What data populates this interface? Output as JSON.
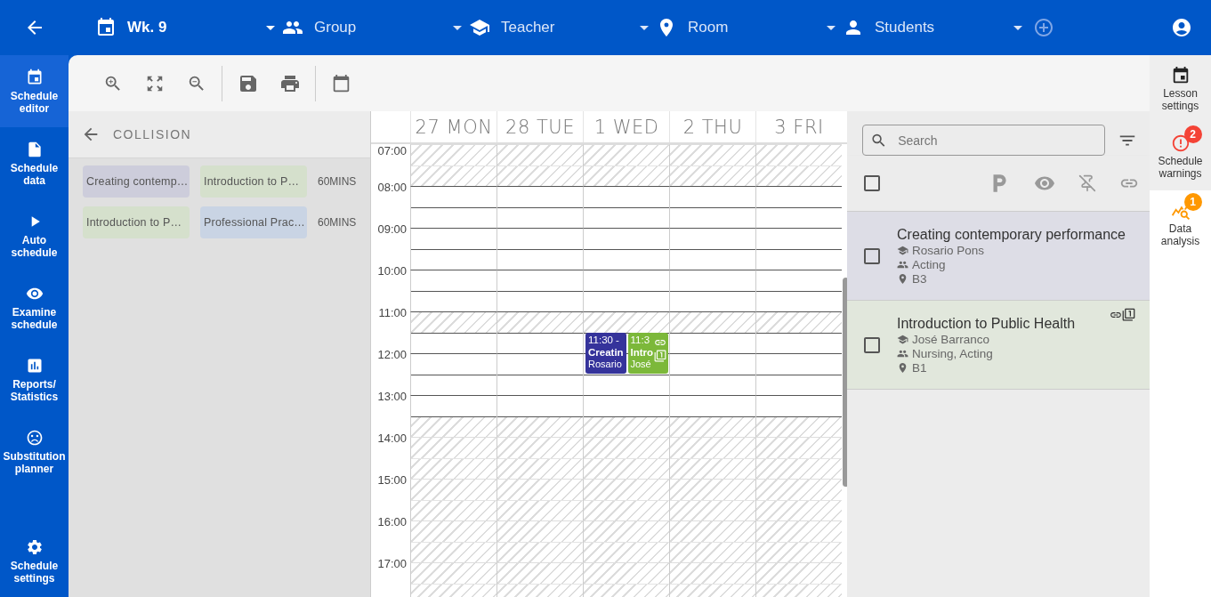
{
  "topbar": {
    "filters": [
      {
        "kind": "week",
        "label": "Wk. 9",
        "active": true
      },
      {
        "kind": "group",
        "label": "Group",
        "active": false
      },
      {
        "kind": "teacher",
        "label": "Teacher",
        "active": false
      },
      {
        "kind": "room",
        "label": "Room",
        "active": false
      },
      {
        "kind": "student",
        "label": "Students",
        "active": false
      }
    ]
  },
  "sidebar": {
    "items": [
      {
        "kind": "editor",
        "label": "Schedule editor",
        "selected": true
      },
      {
        "kind": "data",
        "label": "Schedule data",
        "selected": false
      },
      {
        "kind": "auto",
        "label": "Auto schedule",
        "selected": false
      },
      {
        "kind": "examine",
        "label": "Examine schedule",
        "selected": false
      },
      {
        "kind": "reports",
        "label": "Reports/ Statistics",
        "selected": false
      },
      {
        "kind": "substitution",
        "label": "Substitution planner",
        "selected": false
      },
      {
        "kind": "settings",
        "label": "Schedule settings",
        "selected": false
      }
    ]
  },
  "collision": {
    "title": "COLLISION",
    "pairs": [
      {
        "lessons": [
          {
            "label": "Creating contemp…",
            "color": "#cdcddb"
          },
          {
            "label": "Introduction to P…",
            "color": "#d5e0cc"
          }
        ],
        "duration": "60MINS"
      },
      {
        "lessons": [
          {
            "label": "Introduction to P…",
            "color": "#d5e0cc"
          },
          {
            "label": "Professional Prac…",
            "color": "#c9d4e4"
          }
        ],
        "duration": "60MINS"
      }
    ]
  },
  "calendar": {
    "days": [
      {
        "label": "27 MON"
      },
      {
        "label": "28 TUE"
      },
      {
        "label": "1 WED",
        "events": [
          {
            "time": "11:30 -",
            "title": "Creatin",
            "teacher": "Rosario",
            "color": "#35339b",
            "linked": false,
            "starts_second_half": true
          },
          {
            "time": "11:3",
            "title": "Intro",
            "teacher": "José",
            "color": "#7cb83a",
            "linked": true,
            "starts_second_half": true
          }
        ]
      },
      {
        "label": "2 THU"
      },
      {
        "label": "3 FRI"
      }
    ],
    "hours": [
      {
        "label": "07:00",
        "first_half_blocked": true,
        "second_half_blocked": true
      },
      {
        "label": "08:00",
        "first_half_blocked": false,
        "second_half_blocked": false
      },
      {
        "label": "09:00",
        "first_half_blocked": false,
        "second_half_blocked": false
      },
      {
        "label": "10:00",
        "first_half_blocked": false,
        "second_half_blocked": false
      },
      {
        "label": "11:00",
        "first_half_blocked": true,
        "second_half_blocked": false
      },
      {
        "label": "12:00",
        "first_half_blocked": false,
        "second_half_blocked": false
      },
      {
        "label": "13:00",
        "first_half_blocked": false,
        "second_half_blocked": true
      },
      {
        "label": "14:00",
        "first_half_blocked": true,
        "second_half_blocked": true
      },
      {
        "label": "15:00",
        "first_half_blocked": true,
        "second_half_blocked": true
      },
      {
        "label": "16:00",
        "first_half_blocked": true,
        "second_half_blocked": true
      },
      {
        "label": "17:00",
        "first_half_blocked": true,
        "second_half_blocked": true
      }
    ]
  },
  "lessons": {
    "search": {
      "placeholder": "Search"
    },
    "select_all": {
      "checked": false
    },
    "items": [
      {
        "title": "Creating contemporary performance",
        "teacher": "Rosario Pons",
        "groups": "Acting",
        "room": "B3",
        "color": "#dddde6",
        "checked": false,
        "linked": false
      },
      {
        "title": "Introduction to Public Health",
        "teacher": "José Barranco",
        "groups": "Nursing, Acting",
        "room": "B1",
        "color": "#e1e7dc",
        "checked": false,
        "linked": true
      }
    ]
  },
  "right_sidebar": {
    "items": [
      {
        "kind": "lesson",
        "label": "Lesson settings",
        "selected": false
      },
      {
        "kind": "warnings",
        "label": "Schedule warnings",
        "selected": false,
        "badge": "2",
        "color": "#f44336"
      },
      {
        "kind": "analysis",
        "label": "Data analysis",
        "selected": true,
        "badge": "1",
        "color": "#ff9800"
      }
    ]
  }
}
